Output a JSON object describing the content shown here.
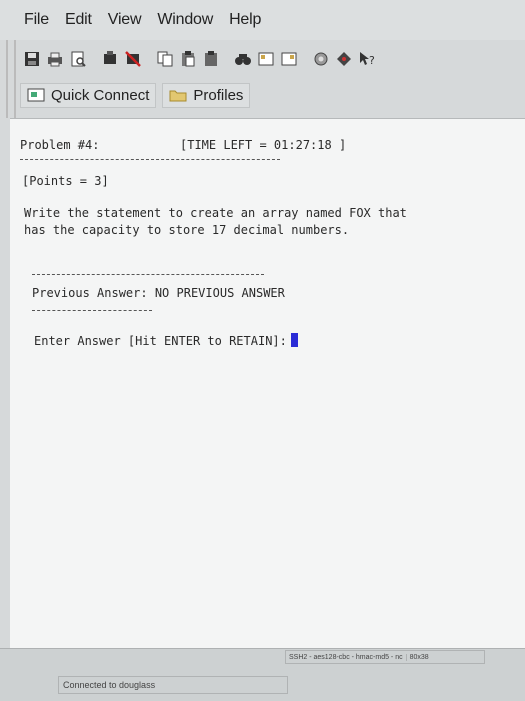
{
  "menu": [
    {
      "label": "File"
    },
    {
      "label": "Edit"
    },
    {
      "label": "View"
    },
    {
      "label": "Window"
    },
    {
      "label": "Help"
    }
  ],
  "quickbar": {
    "quick_connect": "Quick Connect",
    "profiles": "Profiles"
  },
  "terminal": {
    "problem": "Problem #4:",
    "time_left": "[TIME LEFT = 01:27:18 ]",
    "points": "[Points = 3]",
    "question_line1": "Write the statement to create an array named FOX that",
    "question_line2": "has the capacity to store 17 decimal numbers.",
    "previous_answer": "Previous Answer: NO PREVIOUS ANSWER",
    "enter_answer": "Enter Answer [Hit ENTER to RETAIN]:"
  },
  "status": {
    "connection": "Connected to douglass",
    "protocol": "SSH2 - aes128-cbc - hmac-md5 - nc",
    "size": "80x38"
  }
}
